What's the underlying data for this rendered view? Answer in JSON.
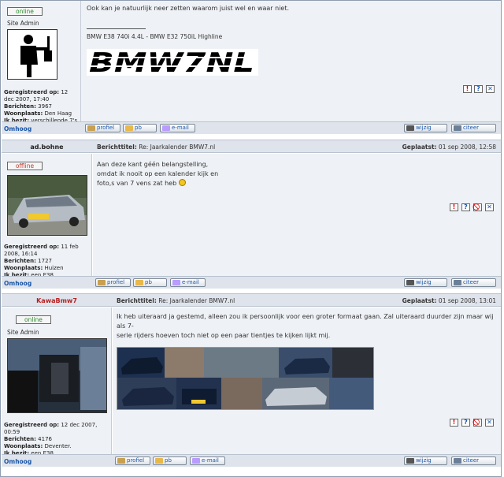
{
  "posts": [
    {
      "author": "",
      "status": "online",
      "rank": "Site Admin",
      "meta": [
        {
          "k": "Geregistreerd op:",
          "v": " 12 dec 2007, 17:40"
        },
        {
          "k": "Berichten:",
          "v": " 3967"
        },
        {
          "k": "Woonplaats:",
          "v": " Den Haag"
        },
        {
          "k": "Ik bezit:",
          "v": " verschillende 7's"
        }
      ],
      "body": [
        "Ook kan je natuurlijk neer zetten waarom juist wel en waar niet."
      ],
      "signature": "BMW E38 740i 4.4L - BMW E32 750iL Highline",
      "logo_text": "BMW7NL"
    },
    {
      "author": "ad.bohne",
      "subject_label": "Berichttitel:",
      "subject": " Re: Jaarkalender BMW7.nl",
      "posted_label": "Geplaatst:",
      "posted": " 01 sep 2008, 12:58",
      "status": "offline",
      "meta": [
        {
          "k": "Geregistreerd op:",
          "v": " 11 feb 2008, 16:14"
        },
        {
          "k": "Berichten:",
          "v": " 1727"
        },
        {
          "k": "Woonplaats:",
          "v": " Huizen"
        },
        {
          "k": "Ik bezit:",
          "v": " een E38"
        }
      ],
      "body": [
        "Aan deze kant géén belangstelling,",
        "omdat ik nooit op een kalender kijk en",
        "foto,s van 7 vens zat heb"
      ]
    },
    {
      "author": "KawaBmw7",
      "subject_label": "Berichttitel:",
      "subject": " Re: Jaarkalender BMW7.nl",
      "posted_label": "Geplaatst:",
      "posted": " 01 sep 2008, 13:01",
      "status": "online",
      "rank": "Site Admin",
      "meta": [
        {
          "k": "Geregistreerd op:",
          "v": " 12 dec 2007, 00:59"
        },
        {
          "k": "Berichten:",
          "v": " 4176"
        },
        {
          "k": "Woonplaats:",
          "v": " Deventer."
        },
        {
          "k": "Ik bezit:",
          "v": " een E38"
        }
      ],
      "body": [
        "Ik heb uiteraard ja gestemd, alleen zou ik persoonlijk voor een groter formaat gaan. Zal uiteraard duurder zijn maar wij als 7-",
        "serie rijders hoeven toch niet op een paar tientjes te kijken lijkt mij."
      ]
    }
  ],
  "footer": {
    "omhoog": "Omhoog",
    "profiel": "profiel",
    "pb": "pb",
    "email": "e-mail",
    "wijzig": "wijzig",
    "citeer": "citeer"
  },
  "icons": {
    "report": "!",
    "info": "?",
    "ban": "⃠",
    "delete": "✕"
  }
}
